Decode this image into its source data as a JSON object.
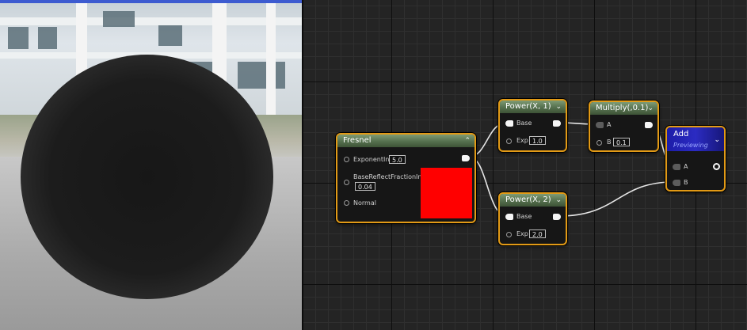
{
  "viewport": {
    "label": "material-preview-sphere"
  },
  "nodes": {
    "fresnel": {
      "title": "Fresnel",
      "inputs": {
        "exponent": {
          "label": "ExponentIn",
          "value": "5.0"
        },
        "base_reflect": {
          "label": "BaseReflectFractionIn",
          "value": "0.04"
        },
        "normal": {
          "label": "Normal"
        }
      },
      "preview_color": "#ff0000"
    },
    "power1": {
      "title": "Power(X, 1)",
      "base_label": "Base",
      "exp_label": "Exp",
      "exp_value": "1.0"
    },
    "power2": {
      "title": "Power(X, 2)",
      "base_label": "Base",
      "exp_label": "Exp",
      "exp_value": "2.0"
    },
    "multiply": {
      "title": "Multiply(,0.1)",
      "a_label": "A",
      "b_label": "B",
      "b_value": "0.1"
    },
    "add": {
      "title": "Add",
      "subtitle": "Previewing",
      "a_label": "A",
      "b_label": "B"
    }
  },
  "colors": {
    "node_border": "#e29a16",
    "header_green": "#55704e",
    "header_blue": "#2b2bc2",
    "wire": "#e6e6e6"
  },
  "icons": {
    "collapse": "chevron-up-icon",
    "expand": "chevron-down-icon"
  }
}
